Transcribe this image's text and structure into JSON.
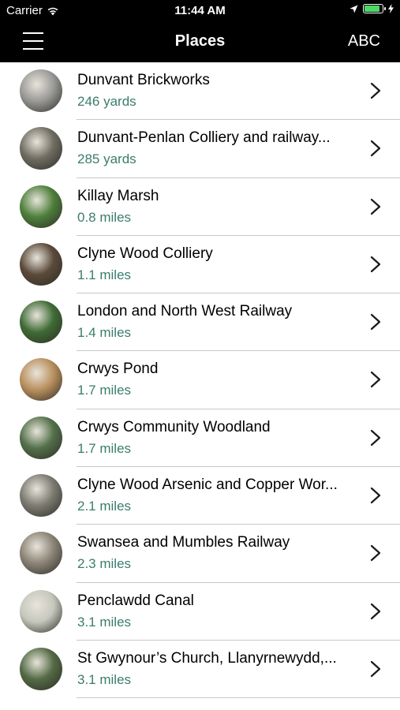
{
  "status": {
    "carrier": "Carrier",
    "time": "11:44 AM"
  },
  "nav": {
    "title": "Places",
    "sort_button": "ABC"
  },
  "places": [
    {
      "name": "Dunvant Brickworks",
      "distance": "246 yards",
      "thumb_color": "#9a9a98"
    },
    {
      "name": "Dunvant-Penlan Colliery and railway...",
      "distance": "285 yards",
      "thumb_color": "#6f6c62"
    },
    {
      "name": "Killay Marsh",
      "distance": "0.8 miles",
      "thumb_color": "#4e7f3c"
    },
    {
      "name": "Clyne Wood Colliery",
      "distance": "1.1 miles",
      "thumb_color": "#5b4a3a"
    },
    {
      "name": "London and North West Railway",
      "distance": "1.4 miles",
      "thumb_color": "#3f6b36"
    },
    {
      "name": "Crwys Pond",
      "distance": "1.7 miles",
      "thumb_color": "#b9905e"
    },
    {
      "name": "Crwys Community Woodland",
      "distance": "1.7 miles",
      "thumb_color": "#53704a"
    },
    {
      "name": "Clyne Wood Arsenic and Copper Wor...",
      "distance": "2.1 miles",
      "thumb_color": "#7c7b71"
    },
    {
      "name": "Swansea and Mumbles Railway",
      "distance": "2.3 miles",
      "thumb_color": "#8b8476"
    },
    {
      "name": "Penclawdd Canal",
      "distance": "3.1 miles",
      "thumb_color": "#c6c8bd"
    },
    {
      "name": "St Gwynour’s Church, Llanyrnewydd,...",
      "distance": "3.1 miles",
      "thumb_color": "#546a45"
    }
  ]
}
